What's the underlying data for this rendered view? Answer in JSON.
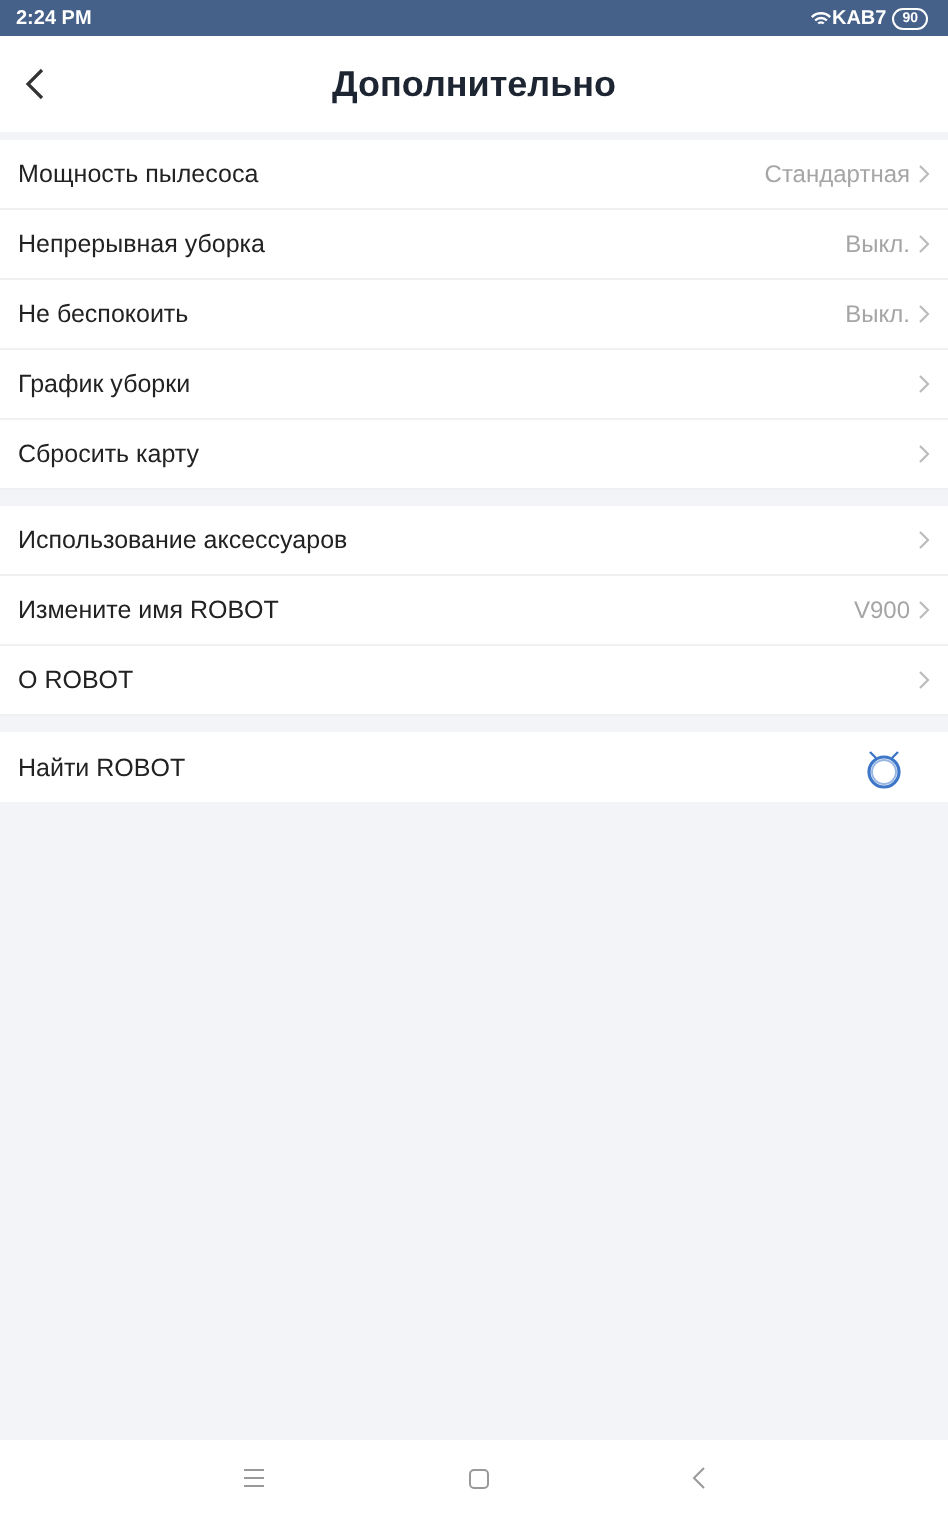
{
  "status_bar": {
    "time": "2:24 PM",
    "carrier": "KAB7",
    "battery": "90"
  },
  "header": {
    "title": "Дополнительно"
  },
  "groups": [
    {
      "rows": [
        {
          "kind": "link",
          "label": "Мощность пылесоса",
          "value": "Стандартная"
        },
        {
          "kind": "link",
          "label": "Непрерывная уборка",
          "value": "Выкл."
        },
        {
          "kind": "link",
          "label": "Не беспокоить",
          "value": "Выкл."
        },
        {
          "kind": "link",
          "label": "График уборки"
        },
        {
          "kind": "link",
          "label": "Сбросить карту"
        }
      ]
    },
    {
      "rows": [
        {
          "kind": "link",
          "label": "Использование аксессуаров"
        },
        {
          "kind": "link",
          "label": "Измените имя ROBOT",
          "value": "V900"
        },
        {
          "kind": "link",
          "label": "О ROBOT"
        }
      ]
    },
    {
      "rows": [
        {
          "kind": "locate",
          "label": "Найти ROBOT"
        }
      ]
    }
  ]
}
